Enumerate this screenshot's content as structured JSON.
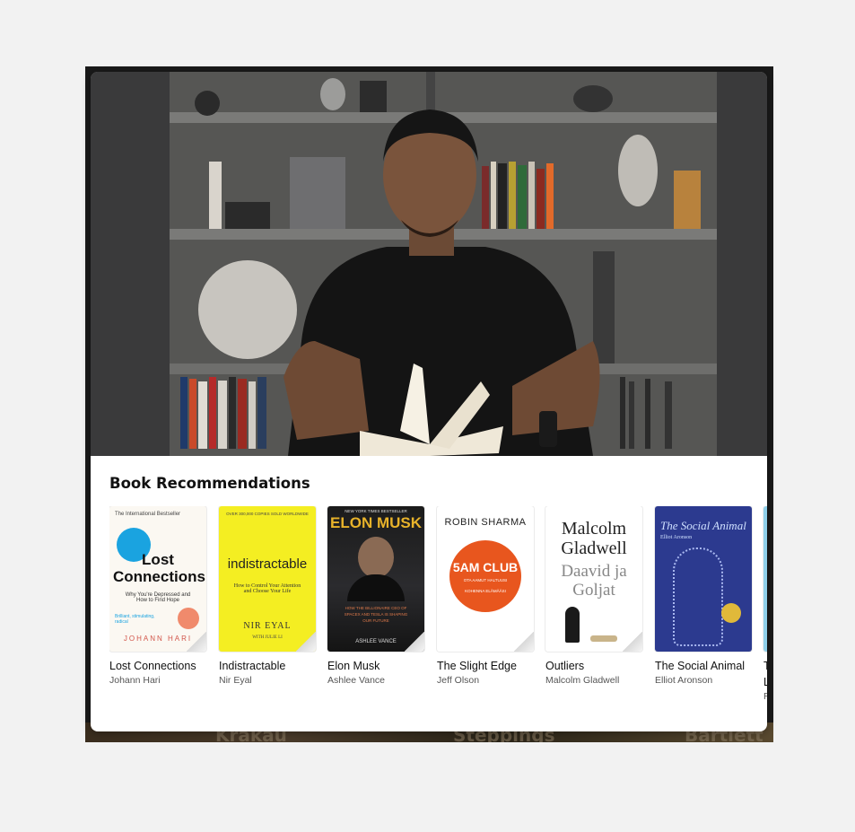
{
  "background": {
    "texts": [
      "Krakau",
      "Steppings",
      "Bartlett"
    ]
  },
  "card": {
    "section_title": "Book Recommendations",
    "books": [
      {
        "title": "Lost Connections",
        "author": "Johann Hari",
        "cover": {
          "top": "The International Bestseller",
          "heading": "Lost Connections",
          "sub": "Why You're Depressed and How to Find Hope",
          "quote": "Brilliant, stimulating, radical",
          "bottom": "JOHANN HARI"
        }
      },
      {
        "title": "Indistractable",
        "author": "Nir Eyal",
        "cover": {
          "top": "OVER 300,000 COPIES SOLD WORLDWIDE",
          "heading": "indistractable",
          "sub": "How to Control Your Attention and Choose Your Life",
          "bottom": "NIR EYAL",
          "bottom_sub": "WITH JULIE LI"
        }
      },
      {
        "title": "Elon Musk",
        "author": "Ashlee Vance",
        "cover": {
          "top": "NEW YORK TIMES BESTSELLER",
          "heading": "ELON MUSK",
          "sub": "HOW THE BILLIONAIRE CEO OF SPACEX AND TESLA IS SHAPING OUR FUTURE",
          "bottom": "ASHLEE VANCE"
        }
      },
      {
        "title": "The Slight Edge",
        "author": "Jeff Olson",
        "cover": {
          "heading": "ROBIN SHARMA",
          "badge": "5AM CLUB",
          "sub": "OTA AAMUT HALTUUSI",
          "sub2": "KOHENNA ELÄMÄÄSI"
        }
      },
      {
        "title": "Outliers",
        "author": "Malcolm Gladwell",
        "cover": {
          "heading": "Malcolm Gladwell",
          "sub": "Daavid ja Goljat"
        }
      },
      {
        "title": "The Social Animal",
        "author": "Elliot Aronson",
        "cover": {
          "heading": "The Social Animal",
          "sub": "Elliot Aronson"
        }
      },
      {
        "title": "T",
        "author": "R",
        "title_line2": "L"
      }
    ]
  },
  "colors": {
    "accent_blue": "#1aa3e0",
    "salmon": "#f08a6c",
    "yellow": "#f4ee22",
    "orange": "#e8561e",
    "navy": "#2c3a8f"
  }
}
